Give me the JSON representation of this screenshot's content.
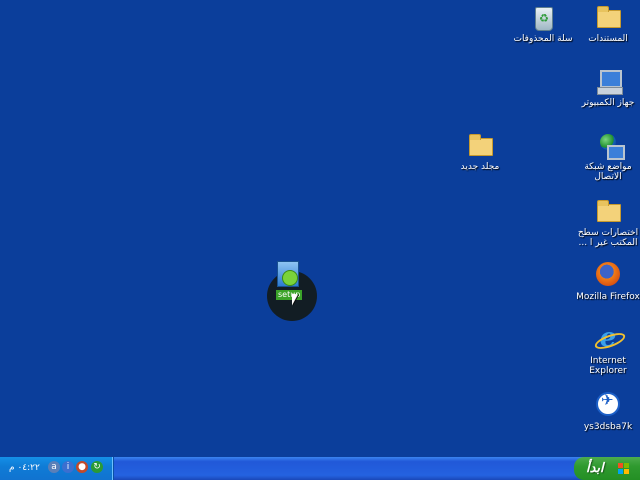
{
  "desktop": {
    "icons": [
      {
        "label": "المستندات",
        "icon": "folder-icon"
      },
      {
        "label": "سلة المحذوفات",
        "icon": "recycle-bin-icon"
      },
      {
        "label": "جهاز الكمبيوتر",
        "icon": "computer-icon"
      },
      {
        "label": "مجلد جديد",
        "icon": "folder-icon"
      },
      {
        "label": "مواضع شبكة الاتصال",
        "icon": "network-icon"
      },
      {
        "label": "اختصارات سطح المكتب غير ا ...",
        "icon": "folder-icon"
      },
      {
        "label": "Mozilla Firefox",
        "icon": "firefox-icon"
      },
      {
        "label": "Internet Explorer",
        "icon": "ie-icon"
      },
      {
        "label": "ys3dsba7k",
        "icon": "app-icon"
      },
      {
        "label": "setup",
        "icon": "setup-icon"
      }
    ]
  },
  "taskbar": {
    "start_label": "ابدأ",
    "clock": "٠٤:٢٢ م"
  },
  "colors": {
    "desktop": "#0b3e9b",
    "taskbar": "#2462e0",
    "start": "#2f9a2f"
  }
}
